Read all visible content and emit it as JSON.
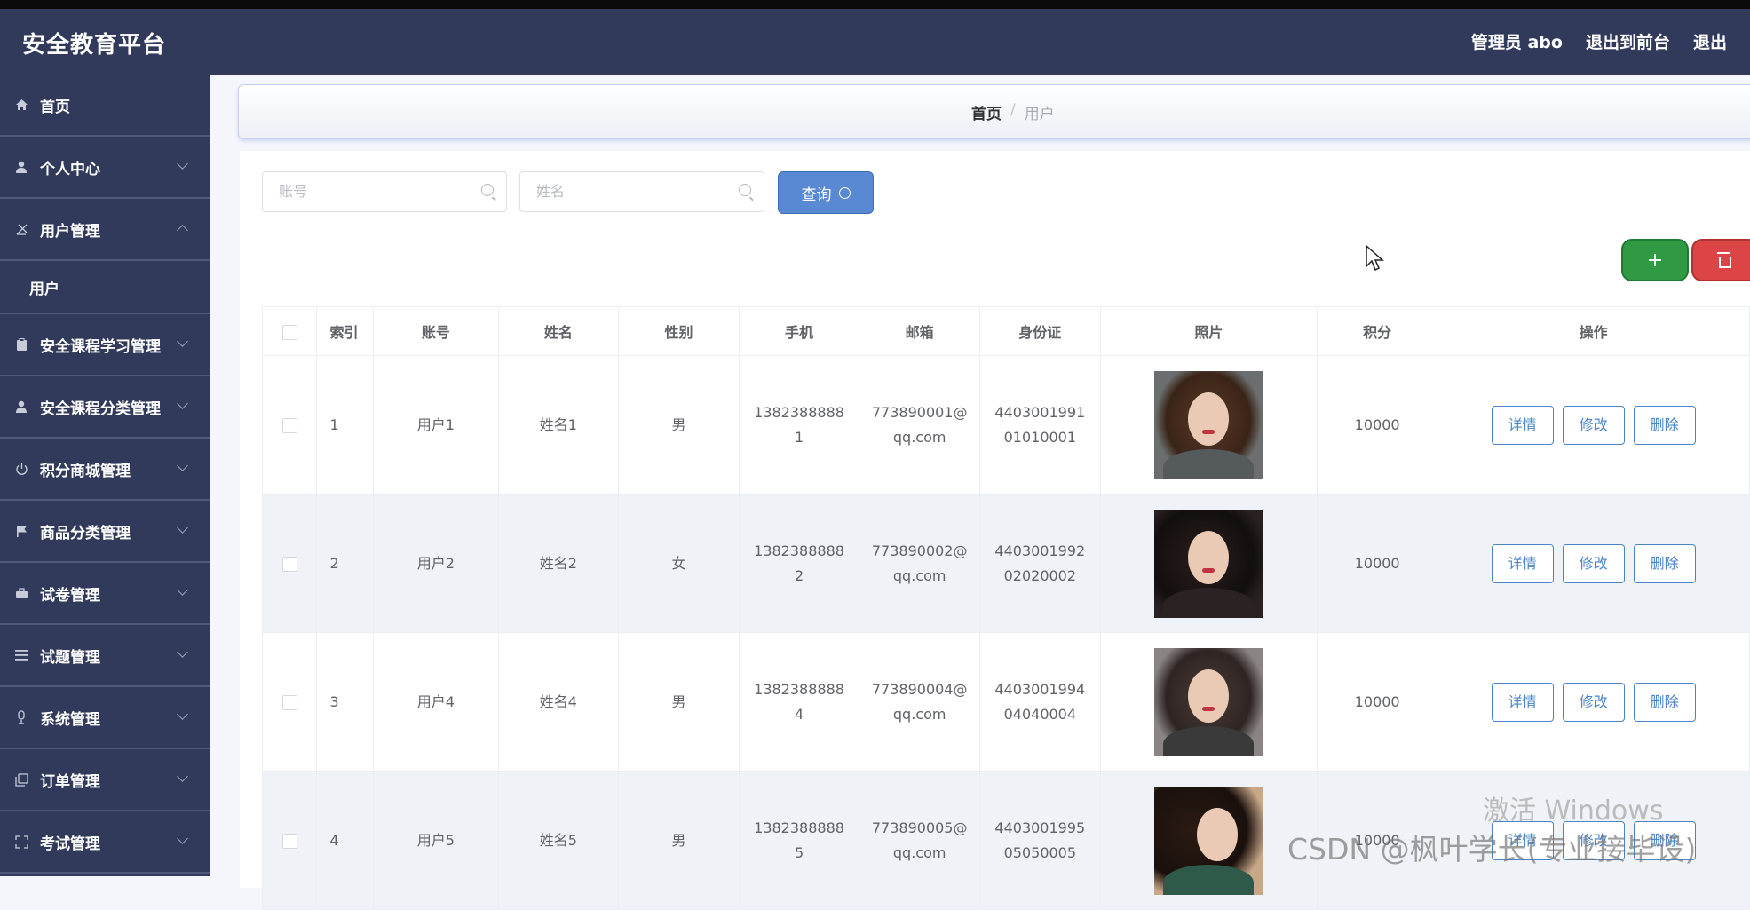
{
  "header": {
    "title": "安全教育平台",
    "admin_label": "管理员 abo",
    "exit_front": "退出到前台",
    "exit": "退出"
  },
  "sidebar": {
    "items": [
      {
        "label": "首页",
        "icon": "home-icon"
      },
      {
        "label": "个人中心",
        "icon": "user-icon"
      },
      {
        "label": "用户管理",
        "icon": "users-icon",
        "expanded": true
      },
      {
        "label": "用户",
        "sub": true
      },
      {
        "label": "安全课程学习管理",
        "icon": "clipboard-icon"
      },
      {
        "label": "安全课程分类管理",
        "icon": "user-icon"
      },
      {
        "label": "积分商城管理",
        "icon": "power-icon"
      },
      {
        "label": "商品分类管理",
        "icon": "flag-icon"
      },
      {
        "label": "试卷管理",
        "icon": "briefcase-icon"
      },
      {
        "label": "试题管理",
        "icon": "list-icon"
      },
      {
        "label": "系统管理",
        "icon": "mic-icon"
      },
      {
        "label": "订单管理",
        "icon": "copy-icon"
      },
      {
        "label": "考试管理",
        "icon": "scan-icon"
      }
    ]
  },
  "breadcrumb": {
    "home": "首页",
    "separator": "/",
    "current": "用户"
  },
  "search": {
    "account_placeholder": "账号",
    "name_placeholder": "姓名",
    "query_label": "查询"
  },
  "actions": {
    "add": "+",
    "add_color": "#2f9a43",
    "delete_color": "#dc4545"
  },
  "table": {
    "columns": [
      "索引",
      "账号",
      "姓名",
      "性别",
      "手机",
      "邮箱",
      "身份证",
      "照片",
      "积分",
      "操作"
    ],
    "rows": [
      {
        "index": "1",
        "account": "用户1",
        "name": "姓名1",
        "gender": "男",
        "phone_a": "1382388888",
        "phone_b": "1",
        "email_a": "773890001@",
        "email_b": "qq.com",
        "id_a": "4403001991",
        "id_b": "01010001",
        "points": "10000"
      },
      {
        "index": "2",
        "account": "用户2",
        "name": "姓名2",
        "gender": "女",
        "phone_a": "1382388888",
        "phone_b": "2",
        "email_a": "773890002@",
        "email_b": "qq.com",
        "id_a": "4403001992",
        "id_b": "02020002",
        "points": "10000"
      },
      {
        "index": "3",
        "account": "用户4",
        "name": "姓名4",
        "gender": "男",
        "phone_a": "1382388888",
        "phone_b": "4",
        "email_a": "773890004@",
        "email_b": "qq.com",
        "id_a": "4403001994",
        "id_b": "04040004",
        "points": "10000"
      },
      {
        "index": "4",
        "account": "用户5",
        "name": "姓名5",
        "gender": "男",
        "phone_a": "1382388888",
        "phone_b": "5",
        "email_a": "773890005@",
        "email_b": "qq.com",
        "id_a": "4403001995",
        "id_b": "05050005",
        "points": "10000"
      }
    ],
    "row_actions": {
      "detail": "详情",
      "edit": "修改",
      "delete": "删除"
    }
  },
  "watermarks": {
    "windows": "激活 Windows",
    "csdn": "CSDN @枫叶学长(专业接毕设)"
  }
}
